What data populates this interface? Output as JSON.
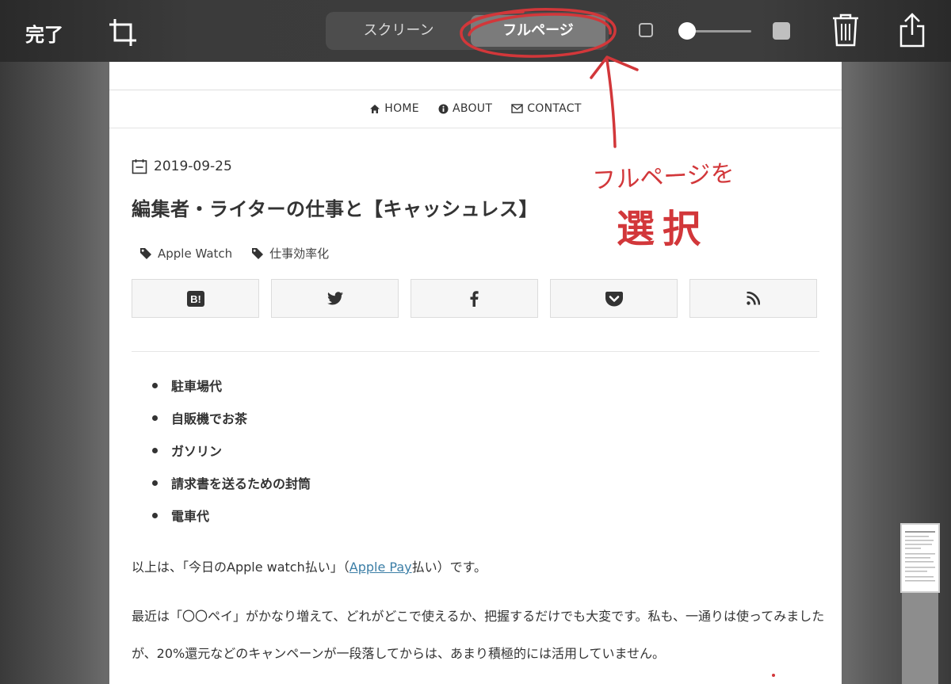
{
  "toolbar": {
    "done_label": "完了",
    "segments": {
      "screen": "スクリーン",
      "full_page": "フルページ"
    },
    "selected_segment": "フルページ",
    "slider_level": 0.05
  },
  "nav": {
    "home": "HOME",
    "about": "ABOUT",
    "contact": "CONTACT"
  },
  "post": {
    "date": "2019-09-25",
    "title": "編集者・ライターの仕事と【キャッシュレス】",
    "tags": [
      "Apple Watch",
      "仕事効率化"
    ],
    "share_icons": [
      "hatena-bookmark-icon",
      "twitter-icon",
      "facebook-icon",
      "pocket-icon",
      "rss-icon"
    ],
    "share_hatena_text": "B!",
    "bullets": [
      "駐車場代",
      "自販機でお茶",
      "ガソリン",
      "請求書を送るための封筒",
      "電車代"
    ],
    "para1_before": "以上は、「今日のApple watch払い」（",
    "para1_link": "Apple Pay",
    "para1_after": "払い）です。",
    "para2": "最近は「〇〇ペイ」がかなり増えて、どれがどこで使えるか、把握するだけでも大変です。私も、一通りは使ってみましたが、20%還元などのキャンペーンが一段落してからは、あまり積極的には活用していません。"
  },
  "annotation": {
    "line1": "フルページを",
    "line2": "選択",
    "color": "#d2373a"
  }
}
